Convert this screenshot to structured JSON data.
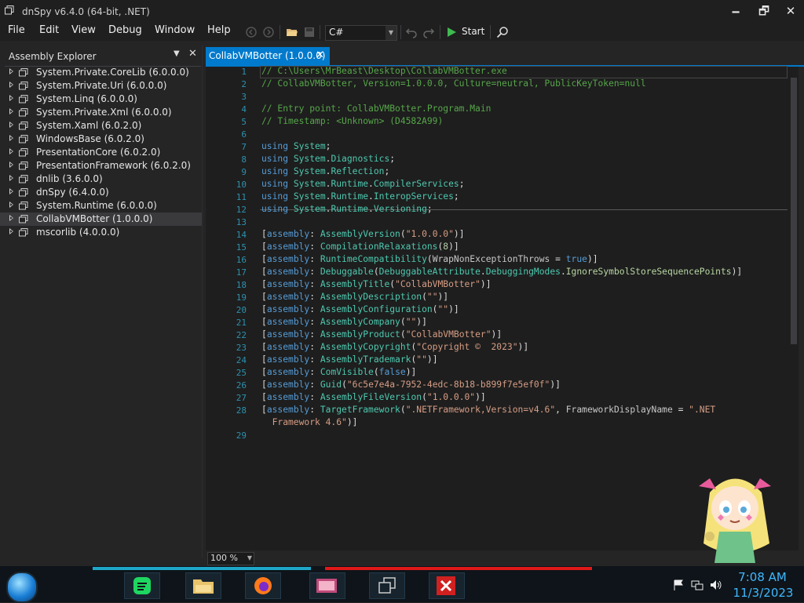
{
  "window": {
    "title": "dnSpy v6.4.0 (64-bit, .NET)",
    "minimize": "🗕",
    "restore": "🗗",
    "close": "✕"
  },
  "menu": [
    "File",
    "Edit",
    "View",
    "Debug",
    "Window",
    "Help"
  ],
  "toolbar": {
    "language": "C#",
    "start_label": "Start"
  },
  "explorer": {
    "title": "Assembly Explorer",
    "pin": "▼",
    "close": "✕",
    "items": [
      {
        "label": "System.Private.CoreLib (6.0.0.0)",
        "selected": false
      },
      {
        "label": "System.Private.Uri (6.0.0.0)",
        "selected": false
      },
      {
        "label": "System.Linq (6.0.0.0)",
        "selected": false
      },
      {
        "label": "System.Private.Xml (6.0.0.0)",
        "selected": false
      },
      {
        "label": "System.Xaml (6.0.2.0)",
        "selected": false
      },
      {
        "label": "WindowsBase (6.0.2.0)",
        "selected": false
      },
      {
        "label": "PresentationCore (6.0.2.0)",
        "selected": false
      },
      {
        "label": "PresentationFramework (6.0.2.0)",
        "selected": false
      },
      {
        "label": "dnlib (3.6.0.0)",
        "selected": false
      },
      {
        "label": "dnSpy (6.4.0.0)",
        "selected": false
      },
      {
        "label": "System.Runtime (6.0.0.0)",
        "selected": false
      },
      {
        "label": "CollabVMBotter (1.0.0.0)",
        "selected": true
      },
      {
        "label": "mscorlib (4.0.0.0)",
        "selected": false
      }
    ]
  },
  "tab": {
    "label": "CollabVMBotter (1.0.0.0)",
    "close": "✕"
  },
  "code_lines": [
    [
      [
        "c-com",
        "// C:\\Users\\MrBeast\\Desktop\\CollabVMBotter.exe"
      ]
    ],
    [
      [
        "c-com",
        "// CollabVMBotter, Version=1.0.0.0, Culture=neutral, PublicKeyToken=null"
      ]
    ],
    [],
    [
      [
        "c-com",
        "// Entry point: CollabVMBotter.Program.Main"
      ]
    ],
    [
      [
        "c-com",
        "// Timestamp: <Unknown> (D4582A99)"
      ]
    ],
    [],
    [
      [
        "c-kw",
        "using "
      ],
      [
        "c-ns",
        "System"
      ],
      [
        "c-pl",
        ";"
      ]
    ],
    [
      [
        "c-kw",
        "using "
      ],
      [
        "c-ns",
        "System"
      ],
      [
        "c-pl",
        "."
      ],
      [
        "c-ns",
        "Diagnostics"
      ],
      [
        "c-pl",
        ";"
      ]
    ],
    [
      [
        "c-kw",
        "using "
      ],
      [
        "c-ns",
        "System"
      ],
      [
        "c-pl",
        "."
      ],
      [
        "c-ns",
        "Reflection"
      ],
      [
        "c-pl",
        ";"
      ]
    ],
    [
      [
        "c-kw",
        "using "
      ],
      [
        "c-ns",
        "System"
      ],
      [
        "c-pl",
        "."
      ],
      [
        "c-ns",
        "Runtime"
      ],
      [
        "c-pl",
        "."
      ],
      [
        "c-ns",
        "CompilerServices"
      ],
      [
        "c-pl",
        ";"
      ]
    ],
    [
      [
        "c-kw",
        "using "
      ],
      [
        "c-ns",
        "System"
      ],
      [
        "c-pl",
        "."
      ],
      [
        "c-ns",
        "Runtime"
      ],
      [
        "c-pl",
        "."
      ],
      [
        "c-ns",
        "InteropServices"
      ],
      [
        "c-pl",
        ";"
      ]
    ],
    [
      [
        "c-kw",
        "using "
      ],
      [
        "c-ns",
        "System"
      ],
      [
        "c-pl",
        "."
      ],
      [
        "c-ns",
        "Runtime"
      ],
      [
        "c-pl",
        "."
      ],
      [
        "c-ns",
        "Versioning"
      ],
      [
        "c-pl",
        ";"
      ]
    ],
    [],
    [
      [
        "c-pl",
        "["
      ],
      [
        "c-kw",
        "assembly"
      ],
      [
        "c-pl",
        ": "
      ],
      [
        "c-ty",
        "AssemblyVersion"
      ],
      [
        "c-pl",
        "("
      ],
      [
        "c-str",
        "\"1.0.0.0\""
      ],
      [
        "c-pl",
        ")]"
      ]
    ],
    [
      [
        "c-pl",
        "["
      ],
      [
        "c-kw",
        "assembly"
      ],
      [
        "c-pl",
        ": "
      ],
      [
        "c-ty",
        "CompilationRelaxations"
      ],
      [
        "c-pl",
        "("
      ],
      [
        "c-num",
        "8"
      ],
      [
        "c-pl",
        ")]"
      ]
    ],
    [
      [
        "c-pl",
        "["
      ],
      [
        "c-kw",
        "assembly"
      ],
      [
        "c-pl",
        ": "
      ],
      [
        "c-ty",
        "RuntimeCompatibility"
      ],
      [
        "c-pl",
        "("
      ],
      [
        "c-prop",
        "WrapNonExceptionThrows"
      ],
      [
        "c-pl",
        " = "
      ],
      [
        "c-kw",
        "true"
      ],
      [
        "c-pl",
        ")]"
      ]
    ],
    [
      [
        "c-pl",
        "["
      ],
      [
        "c-kw",
        "assembly"
      ],
      [
        "c-pl",
        ": "
      ],
      [
        "c-ty",
        "Debuggable"
      ],
      [
        "c-pl",
        "("
      ],
      [
        "c-ty",
        "DebuggableAttribute"
      ],
      [
        "c-pl",
        "."
      ],
      [
        "c-ty",
        "DebuggingModes"
      ],
      [
        "c-pl",
        "."
      ],
      [
        "c-en",
        "IgnoreSymbolStoreSequencePoints"
      ],
      [
        "c-pl",
        ")]"
      ]
    ],
    [
      [
        "c-pl",
        "["
      ],
      [
        "c-kw",
        "assembly"
      ],
      [
        "c-pl",
        ": "
      ],
      [
        "c-ty",
        "AssemblyTitle"
      ],
      [
        "c-pl",
        "("
      ],
      [
        "c-str",
        "\"CollabVMBotter\""
      ],
      [
        "c-pl",
        ")]"
      ]
    ],
    [
      [
        "c-pl",
        "["
      ],
      [
        "c-kw",
        "assembly"
      ],
      [
        "c-pl",
        ": "
      ],
      [
        "c-ty",
        "AssemblyDescription"
      ],
      [
        "c-pl",
        "("
      ],
      [
        "c-str",
        "\"\""
      ],
      [
        "c-pl",
        ")]"
      ]
    ],
    [
      [
        "c-pl",
        "["
      ],
      [
        "c-kw",
        "assembly"
      ],
      [
        "c-pl",
        ": "
      ],
      [
        "c-ty",
        "AssemblyConfiguration"
      ],
      [
        "c-pl",
        "("
      ],
      [
        "c-str",
        "\"\""
      ],
      [
        "c-pl",
        ")]"
      ]
    ],
    [
      [
        "c-pl",
        "["
      ],
      [
        "c-kw",
        "assembly"
      ],
      [
        "c-pl",
        ": "
      ],
      [
        "c-ty",
        "AssemblyCompany"
      ],
      [
        "c-pl",
        "("
      ],
      [
        "c-str",
        "\"\""
      ],
      [
        "c-pl",
        ")]"
      ]
    ],
    [
      [
        "c-pl",
        "["
      ],
      [
        "c-kw",
        "assembly"
      ],
      [
        "c-pl",
        ": "
      ],
      [
        "c-ty",
        "AssemblyProduct"
      ],
      [
        "c-pl",
        "("
      ],
      [
        "c-str",
        "\"CollabVMBotter\""
      ],
      [
        "c-pl",
        ")]"
      ]
    ],
    [
      [
        "c-pl",
        "["
      ],
      [
        "c-kw",
        "assembly"
      ],
      [
        "c-pl",
        ": "
      ],
      [
        "c-ty",
        "AssemblyCopyright"
      ],
      [
        "c-pl",
        "("
      ],
      [
        "c-str",
        "\"Copyright ©  2023\""
      ],
      [
        "c-pl",
        ")]"
      ]
    ],
    [
      [
        "c-pl",
        "["
      ],
      [
        "c-kw",
        "assembly"
      ],
      [
        "c-pl",
        ": "
      ],
      [
        "c-ty",
        "AssemblyTrademark"
      ],
      [
        "c-pl",
        "("
      ],
      [
        "c-str",
        "\"\""
      ],
      [
        "c-pl",
        ")]"
      ]
    ],
    [
      [
        "c-pl",
        "["
      ],
      [
        "c-kw",
        "assembly"
      ],
      [
        "c-pl",
        ": "
      ],
      [
        "c-ty",
        "ComVisible"
      ],
      [
        "c-pl",
        "("
      ],
      [
        "c-kw",
        "false"
      ],
      [
        "c-pl",
        ")]"
      ]
    ],
    [
      [
        "c-pl",
        "["
      ],
      [
        "c-kw",
        "assembly"
      ],
      [
        "c-pl",
        ": "
      ],
      [
        "c-ty",
        "Guid"
      ],
      [
        "c-pl",
        "("
      ],
      [
        "c-str",
        "\"6c5e7e4a-7952-4edc-8b18-b899f7e5ef0f\""
      ],
      [
        "c-pl",
        ")]"
      ]
    ],
    [
      [
        "c-pl",
        "["
      ],
      [
        "c-kw",
        "assembly"
      ],
      [
        "c-pl",
        ": "
      ],
      [
        "c-ty",
        "AssemblyFileVersion"
      ],
      [
        "c-pl",
        "("
      ],
      [
        "c-str",
        "\"1.0.0.0\""
      ],
      [
        "c-pl",
        ")]"
      ]
    ],
    [
      [
        "c-pl",
        "["
      ],
      [
        "c-kw",
        "assembly"
      ],
      [
        "c-pl",
        ": "
      ],
      [
        "c-ty",
        "TargetFramework"
      ],
      [
        "c-pl",
        "("
      ],
      [
        "c-str",
        "\".NETFramework,Version=v4.6\""
      ],
      [
        "c-pl",
        ", "
      ],
      [
        "c-prop",
        "FrameworkDisplayName"
      ],
      [
        "c-pl",
        " = "
      ],
      [
        "c-str",
        "\".NET"
      ]
    ],
    [
      [
        "c-str",
        "  Framework 4.6\""
      ],
      [
        "c-pl",
        ")]"
      ]
    ],
    []
  ],
  "line_numbers": [
    "1",
    "2",
    "3",
    "4",
    "5",
    "6",
    "7",
    "8",
    "9",
    "10",
    "11",
    "12",
    "13",
    "14",
    "15",
    "16",
    "17",
    "18",
    "19",
    "20",
    "21",
    "22",
    "23",
    "24",
    "25",
    "26",
    "27",
    "28",
    "",
    "29"
  ],
  "zoom": {
    "value": "100 %"
  },
  "taskbar": {
    "time": "7:08 AM",
    "date": "11/3/2023"
  },
  "colors": {
    "accent": "#007acc",
    "clock": "#3fb8ff"
  }
}
